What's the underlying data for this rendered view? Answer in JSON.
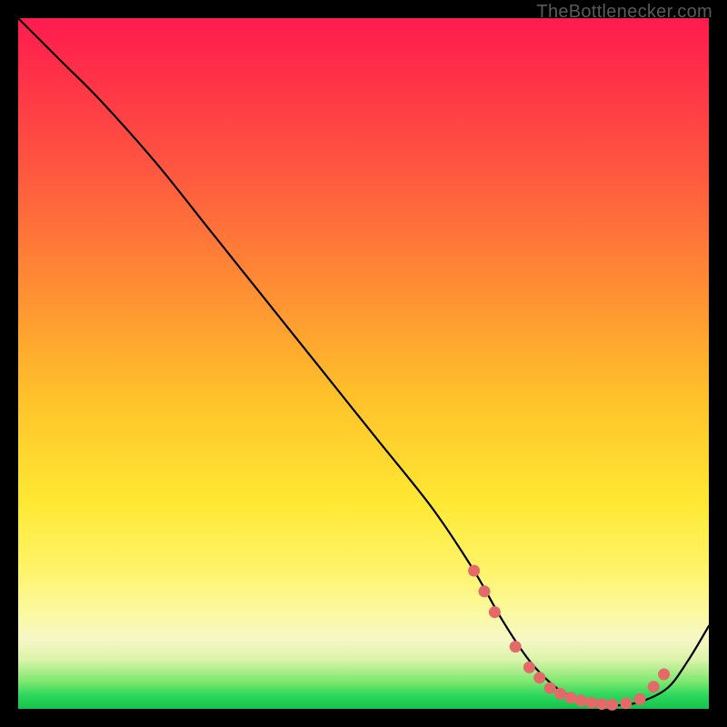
{
  "attribution": "TheBottlenecker.com",
  "chart_data": {
    "type": "line",
    "title": "",
    "xlabel": "",
    "ylabel": "",
    "xlim": [
      0,
      100
    ],
    "ylim": [
      0,
      100
    ],
    "series": [
      {
        "name": "curve",
        "x": [
          0,
          6,
          12,
          20,
          28,
          36,
          44,
          52,
          60,
          66,
          70,
          74,
          78,
          82,
          86,
          90,
          94,
          97,
          100
        ],
        "y": [
          100,
          94,
          88,
          79,
          69,
          59,
          49,
          39,
          29,
          20,
          13,
          7,
          3,
          1,
          0.5,
          1,
          3,
          7,
          12
        ]
      }
    ],
    "dots": {
      "name": "highlight-dots",
      "x": [
        66,
        67.5,
        69,
        72,
        74,
        75.5,
        77,
        78.5,
        80,
        81.5,
        83,
        84.5,
        86,
        88,
        90,
        92,
        93.5
      ],
      "y": [
        20,
        17,
        14,
        9,
        6,
        4.5,
        3,
        2.2,
        1.6,
        1.2,
        0.9,
        0.7,
        0.6,
        0.8,
        1.4,
        3.2,
        5
      ]
    },
    "background_gradient": {
      "top": "#ff1b4f",
      "mid_upper": "#ff8a34",
      "mid": "#ffe833",
      "mid_lower": "#fbf9a0",
      "bottom": "#14c24e"
    }
  }
}
